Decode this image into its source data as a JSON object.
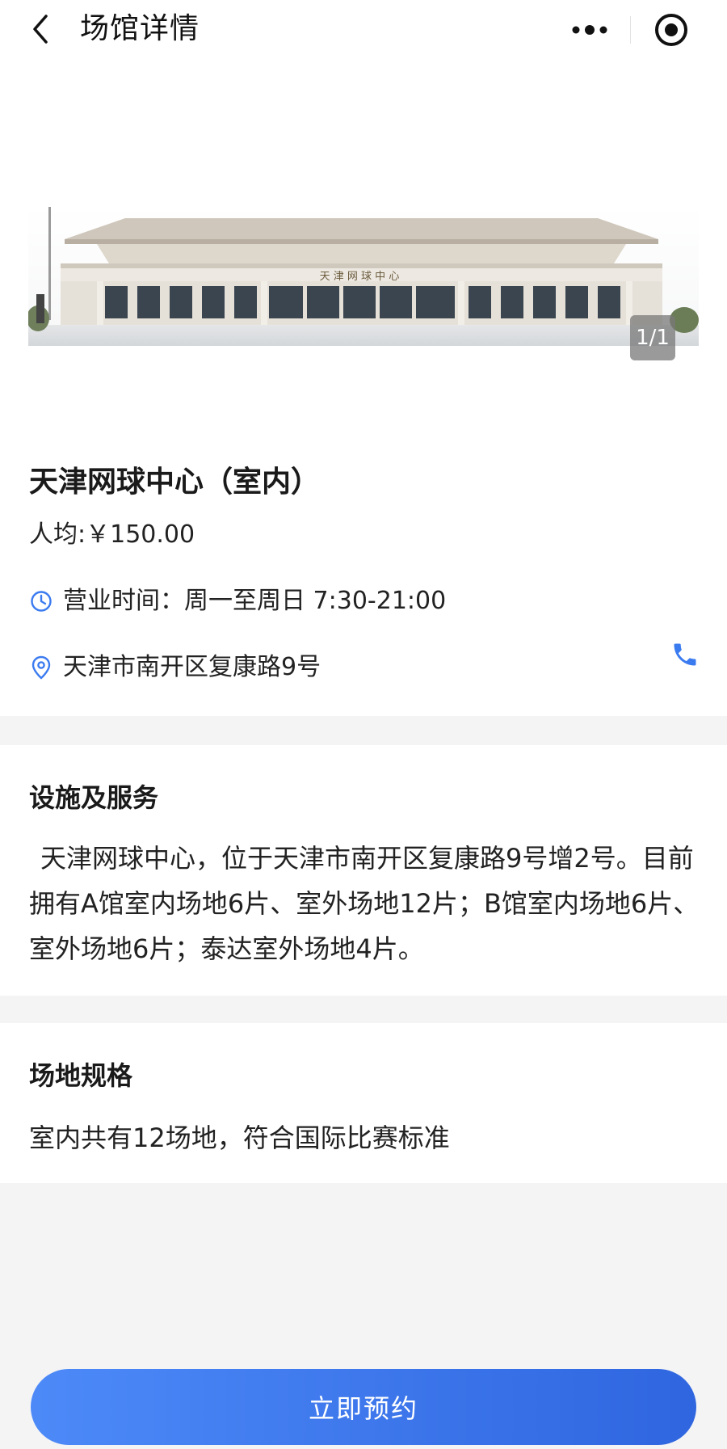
{
  "header": {
    "title": "场馆详情",
    "back_icon": "chevron-left-icon",
    "more_icon": "more-dots-icon",
    "target_icon": "target-circle-icon"
  },
  "hero": {
    "counter": "1/1",
    "sign_text": "天津网球中心"
  },
  "venue": {
    "name": "天津网球中心（室内）",
    "price": "人均:￥150.00",
    "hours": "营业时间：周一至周日 7:30-21:00",
    "address": "天津市南开区复康路9号",
    "hours_icon": "clock-icon",
    "address_icon": "location-pin-icon",
    "phone_icon": "phone-icon"
  },
  "facilities": {
    "title": "设施及服务",
    "body": "天津网球中心，位于天津市南开区复康路9号增2号。目前拥有A馆室内场地6片、室外场地12片；B馆室内场地6片、室外场地6片；泰达室外场地4片。"
  },
  "specs": {
    "title": "场地规格",
    "body": "室内共有12场地，符合国际比赛标准"
  },
  "action": {
    "book_label": "立即预约"
  },
  "colors": {
    "accent": "#3b7bf0",
    "button_start": "#4d8af8",
    "button_end": "#2f66e0",
    "background": "#f4f4f5"
  }
}
